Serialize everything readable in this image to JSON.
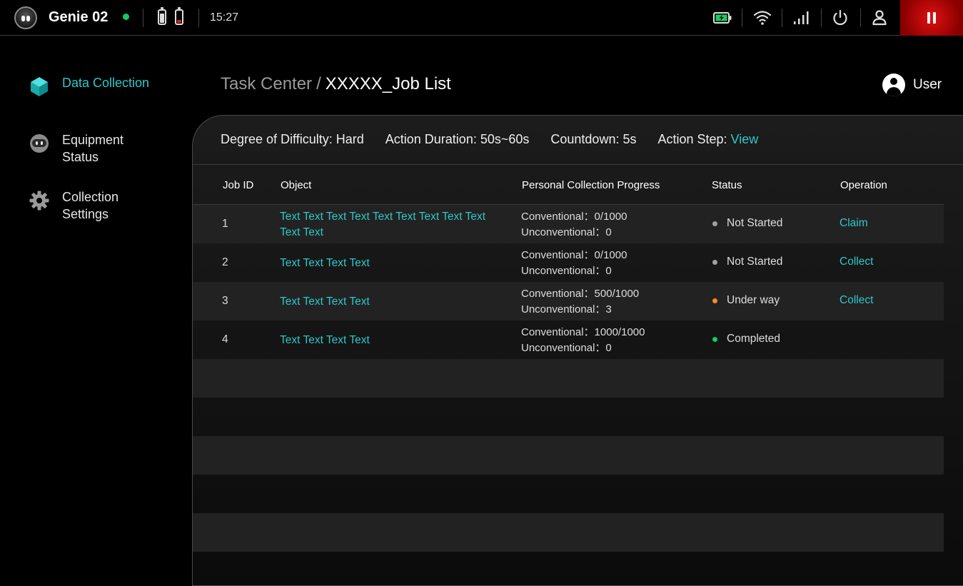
{
  "topbar": {
    "device_name": "Genie 02",
    "time": "15:27",
    "icons": [
      "robot-logo",
      "online-dot",
      "battery-icon",
      "battery-low-icon",
      "charging-battery-icon",
      "wifi-icon",
      "signal-icon",
      "power-icon",
      "user-icon",
      "pause-icon"
    ]
  },
  "colors": {
    "accent": "#2ec7c9",
    "online": "#18c964",
    "stop": "#e01010",
    "grey_status": "#a0a0a0",
    "orange_status": "#ff8a1f",
    "green_status": "#18c964"
  },
  "sidebar": {
    "items": [
      {
        "label": "Data Collection",
        "icon": "cube-icon",
        "active": true
      },
      {
        "label": "Equipment Status",
        "icon": "robot-icon",
        "active": false
      },
      {
        "label": "Collection Settings",
        "icon": "gear-icon",
        "active": false
      }
    ]
  },
  "breadcrumb": {
    "parent": "Task Center",
    "separator": "/",
    "current": "XXXXX_Job List"
  },
  "user": {
    "name": "User"
  },
  "meta": {
    "difficulty": "Degree of Difficulty: Hard",
    "duration": "Action Duration: 50s~60s",
    "countdown": "Countdown: 5s",
    "step_label": "Action Step:",
    "step_link": "View"
  },
  "table": {
    "headers": {
      "id": "Job ID",
      "object": "Object",
      "progress": "Personal Collection Progress",
      "status": "Status",
      "operation": "Operation"
    },
    "rows": [
      {
        "id": "1",
        "object": "Text Text Text Text Text Text Text Text Text Text Text",
        "conv": "Conventional：0/1000",
        "unconv": "Unconventional：0",
        "status": "Not Started",
        "op": "Claim"
      },
      {
        "id": "2",
        "object": "Text Text Text Text",
        "conv": "Conventional：0/1000",
        "unconv": "Unconventional：0",
        "status": "Not Started",
        "op": "Collect"
      },
      {
        "id": "3",
        "object": "Text Text Text Text",
        "conv": "Conventional：500/1000",
        "unconv": "Unconventional：3",
        "status": "Under way",
        "op": "Collect"
      },
      {
        "id": "4",
        "object": "Text Text Text Text",
        "conv": "Conventional：1000/1000",
        "unconv": "Unconventional：0",
        "status": "Completed",
        "op": ""
      }
    ]
  }
}
